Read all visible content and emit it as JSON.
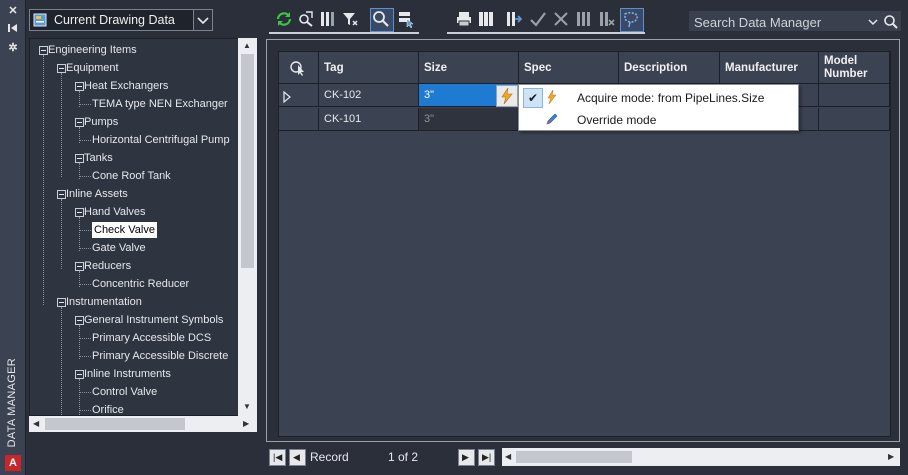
{
  "palette": {
    "accent": "#1e7bd1",
    "panel": "#2b2f3a",
    "grid_bg": "#3b4252",
    "lightning": "#f5a623",
    "refresh_green": "#3cc44a"
  },
  "strip": {
    "title": "DATA MANAGER",
    "buttons": [
      {
        "name": "close-icon",
        "glyph": "✕"
      },
      {
        "name": "auto-hide-icon",
        "glyph": "⧉"
      },
      {
        "name": "properties-icon",
        "glyph": "✲"
      }
    ],
    "logo": "A"
  },
  "datasource": {
    "selected": "Current Drawing Data"
  },
  "tree": {
    "nodes": [
      {
        "label": "Engineering Items",
        "level": 0,
        "expandable": true
      },
      {
        "label": "Equipment",
        "level": 1,
        "expandable": true
      },
      {
        "label": "Heat Exchangers",
        "level": 2,
        "expandable": true
      },
      {
        "label": "TEMA type NEN Exchanger",
        "level": 3,
        "expandable": false
      },
      {
        "label": "Pumps",
        "level": 2,
        "expandable": true
      },
      {
        "label": "Horizontal Centrifugal Pump",
        "level": 3,
        "expandable": false
      },
      {
        "label": "Tanks",
        "level": 2,
        "expandable": true
      },
      {
        "label": "Cone Roof Tank",
        "level": 3,
        "expandable": false
      },
      {
        "label": "Inline Assets",
        "level": 1,
        "expandable": true
      },
      {
        "label": "Hand Valves",
        "level": 2,
        "expandable": true
      },
      {
        "label": "Check Valve",
        "level": 3,
        "expandable": false,
        "selected": true
      },
      {
        "label": "Gate Valve",
        "level": 3,
        "expandable": false
      },
      {
        "label": "Reducers",
        "level": 2,
        "expandable": true
      },
      {
        "label": "Concentric Reducer",
        "level": 3,
        "expandable": false
      },
      {
        "label": "Instrumentation",
        "level": 1,
        "expandable": true
      },
      {
        "label": "General Instrument Symbols",
        "level": 2,
        "expandable": true
      },
      {
        "label": "Primary Accessible DCS",
        "level": 3,
        "expandable": false
      },
      {
        "label": "Primary Accessible Discrete",
        "level": 3,
        "expandable": false
      },
      {
        "label": "Inline Instruments",
        "level": 2,
        "expandable": true
      },
      {
        "label": "Control Valve",
        "level": 3,
        "expandable": false
      },
      {
        "label": "Orifice",
        "level": 3,
        "expandable": false
      }
    ]
  },
  "toolbar": {
    "group1": [
      "refresh-icon",
      "zoom-to-selection-icon",
      "show-columns-icon",
      "filter-icon",
      "find-icon",
      "select-in-drawing-icon"
    ],
    "group2": [
      "print-icon",
      "table-setup-icon",
      "export-icon",
      "accept-icon",
      "reject-icon",
      "hide-columns-icon",
      "delete-column-icon",
      "lasso-icon"
    ]
  },
  "search": {
    "placeholder": "Search Data Manager"
  },
  "grid": {
    "columns": [
      "Tag",
      "Size",
      "Spec",
      "Description",
      "Manufacturer",
      "Model Number"
    ],
    "rows": [
      {
        "tag": "CK-102",
        "size": "3\"",
        "spec": "",
        "description": "",
        "manufacturer": "",
        "model": ""
      },
      {
        "tag": "CK-101",
        "size": "3\"",
        "spec": "",
        "description": "",
        "manufacturer": "",
        "model": ""
      }
    ]
  },
  "popup": {
    "items": [
      {
        "label": "Acquire mode: from PipeLines.Size",
        "icon": "lightning-icon",
        "checked": true
      },
      {
        "label": "Override mode",
        "icon": "pencil-icon",
        "checked": false
      }
    ],
    "check_glyph": "✔"
  },
  "status": {
    "label": "Record",
    "position": "1 of 2"
  }
}
